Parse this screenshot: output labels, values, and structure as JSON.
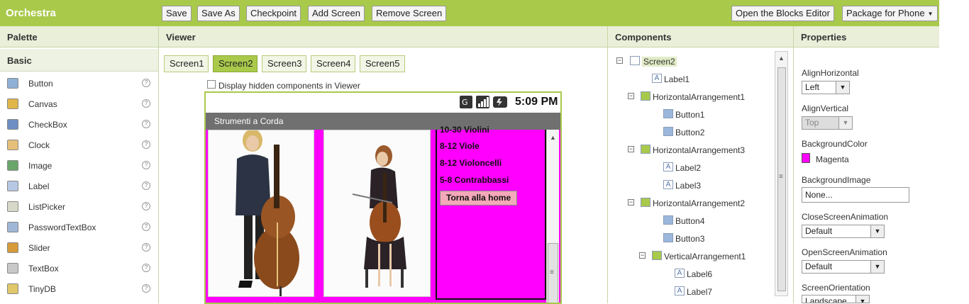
{
  "app": {
    "title": "Orchestra"
  },
  "toolbar": {
    "save": "Save",
    "save_as": "Save As",
    "checkpoint": "Checkpoint",
    "add_screen": "Add Screen",
    "remove_screen": "Remove Screen",
    "blocks_editor": "Open the Blocks Editor",
    "package": "Package for Phone"
  },
  "headers": {
    "palette": "Palette",
    "viewer": "Viewer",
    "components": "Components",
    "properties": "Properties"
  },
  "palette": {
    "section": "Basic",
    "items": [
      {
        "label": "Button",
        "icon": "button-icon"
      },
      {
        "label": "Canvas",
        "icon": "canvas-icon"
      },
      {
        "label": "CheckBox",
        "icon": "checkbox-icon"
      },
      {
        "label": "Clock",
        "icon": "clock-icon"
      },
      {
        "label": "Image",
        "icon": "image-icon"
      },
      {
        "label": "Label",
        "icon": "label-icon"
      },
      {
        "label": "ListPicker",
        "icon": "listpicker-icon"
      },
      {
        "label": "PasswordTextBox",
        "icon": "password-icon"
      },
      {
        "label": "Slider",
        "icon": "slider-icon"
      },
      {
        "label": "TextBox",
        "icon": "textbox-icon"
      },
      {
        "label": "TinyDB",
        "icon": "tinydb-icon"
      }
    ],
    "help": "?"
  },
  "viewer": {
    "screens": [
      "Screen1",
      "Screen2",
      "Screen3",
      "Screen4",
      "Screen5"
    ],
    "active_screen": "Screen2",
    "hidden_components_label": "Display hidden components in Viewer",
    "clock": "5:09 PM",
    "app_title": "Strumenti a Corda",
    "labels": [
      "10-30 Violini",
      "8-12 Viole",
      "8-12 Violoncelli",
      "5-8 Contrabbassi"
    ],
    "home_button": "Torna alla home"
  },
  "components": {
    "tree": [
      {
        "label": "Screen2",
        "toggle": "⊖",
        "icon": "screen-icon"
      },
      {
        "label": "Label1",
        "icon": "label-icon"
      },
      {
        "label": "HorizontalArrangement1",
        "toggle": "⊖",
        "icon": "arrangement-icon"
      },
      {
        "label": "Button1",
        "icon": "button-icon"
      },
      {
        "label": "Button2",
        "icon": "button-icon"
      },
      {
        "label": "HorizontalArrangement3",
        "toggle": "⊖",
        "icon": "arrangement-icon"
      },
      {
        "label": "Label2",
        "icon": "label-icon"
      },
      {
        "label": "Label3",
        "icon": "label-icon"
      },
      {
        "label": "HorizontalArrangement2",
        "toggle": "⊖",
        "icon": "arrangement-icon"
      },
      {
        "label": "Button4",
        "icon": "button-icon"
      },
      {
        "label": "Button3",
        "icon": "button-icon"
      },
      {
        "label": "VerticalArrangement1",
        "toggle": "⊖",
        "icon": "arrangement-icon"
      },
      {
        "label": "Label6",
        "icon": "label-icon"
      },
      {
        "label": "Label7",
        "icon": "label-icon"
      }
    ]
  },
  "properties": {
    "align_horizontal": {
      "label": "AlignHorizontal",
      "value": "Left"
    },
    "align_vertical": {
      "label": "AlignVertical",
      "value": "Top"
    },
    "background_color": {
      "label": "BackgroundColor",
      "value": "Magenta",
      "color": "#ff00ff"
    },
    "background_image": {
      "label": "BackgroundImage",
      "value": "None..."
    },
    "close_animation": {
      "label": "CloseScreenAnimation",
      "value": "Default"
    },
    "open_animation": {
      "label": "OpenScreenAnimation",
      "value": "Default"
    },
    "orientation": {
      "label": "ScreenOrientation",
      "value": "Landscape"
    }
  },
  "colors": {
    "accent": "#a9c94b",
    "magenta": "#ff00ff",
    "title_bar": "#707070",
    "home_button": "#f3a9b9"
  }
}
